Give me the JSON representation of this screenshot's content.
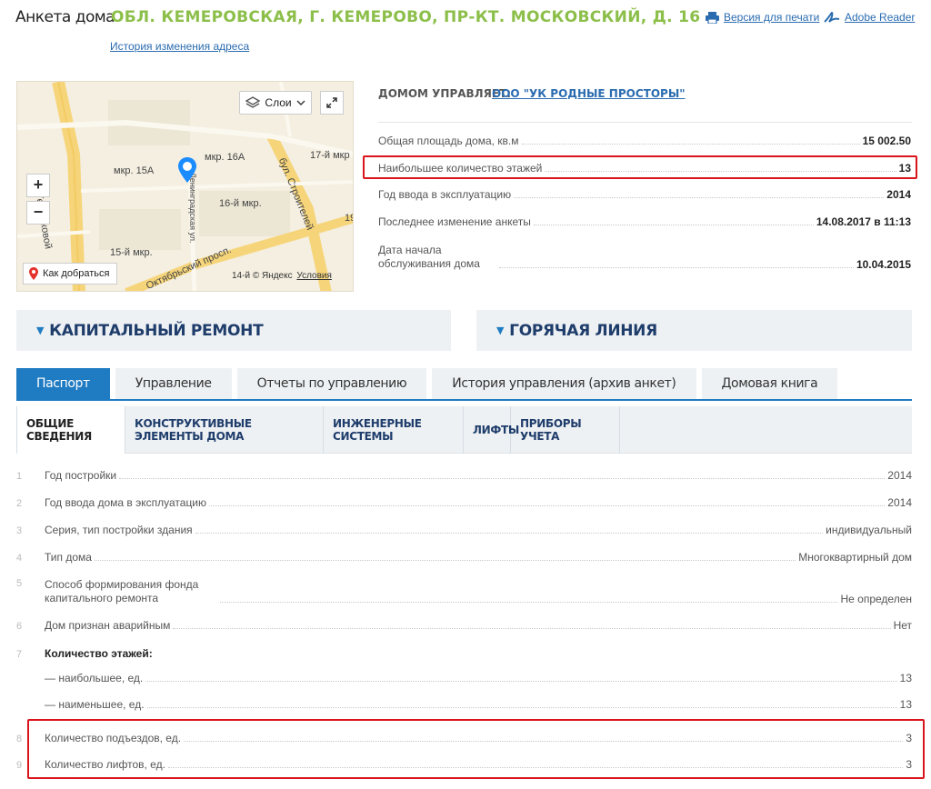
{
  "header": {
    "title": "Анкета дома",
    "address": "ОБЛ. КЕМЕРОВСКАЯ, Г. КЕМЕРОВО, ПР-КТ. МОСКОВСКИЙ, Д. 16",
    "history_link": "История изменения адреса",
    "print_link": "Версия для печати",
    "reader_link": "Adobe Reader"
  },
  "map": {
    "layers_label": "Слои",
    "zoom_in": "+",
    "zoom_out": "−",
    "route_label": "Как добраться",
    "copyright": "© Яндекс",
    "terms": "Условия",
    "labels": {
      "tereshkovoy": "ул. Терешковой",
      "mkr15a": "мкр. 15А",
      "mkr16a": "мкр. 16А",
      "mkr17": "17-й мкр",
      "mkr16": "16-й мкр.",
      "mkr15": "15-й мкр.",
      "mkr14": "14-й",
      "stroiteley": "бул. Строителей",
      "leningradskaya": "Ленинградская ул.",
      "oktyabrsky": "Октябрьский просп.",
      "num19": "19"
    }
  },
  "info": {
    "managed_label": "ДОМОМ УПРАВЛЯЕТ:",
    "managed_company": "ООО \"УК РОДНЫЕ ПРОСТОРЫ\"",
    "rows": [
      {
        "label": "Общая площадь дома, кв.м",
        "value": "15 002.50"
      },
      {
        "label": "Наибольшее количество этажей",
        "value": "13"
      },
      {
        "label": "Год ввода в эксплуатацию",
        "value": "2014"
      },
      {
        "label": "Последнее изменение анкеты",
        "value": "14.08.2017 в 11:13"
      },
      {
        "label": "Дата начала обслуживания дома",
        "value": "10.04.2015"
      }
    ]
  },
  "panels": {
    "capital_repair": "КАПИТАЛЬНЫЙ РЕМОНТ",
    "hotline": "ГОРЯЧАЯ ЛИНИЯ"
  },
  "tabs": [
    "Паспорт",
    "Управление",
    "Отчеты по управлению",
    "История управления (архив анкет)",
    "Домовая книга"
  ],
  "subtabs": [
    "ОБЩИЕ СВЕДЕНИЯ",
    "КОНСТРУКТИВНЫЕ ЭЛЕМЕНТЫ ДОМА",
    "ИНЖЕНЕРНЫЕ СИСТЕМЫ",
    "ЛИФТЫ",
    "ПРИБОРЫ УЧЕТА"
  ],
  "passport": [
    {
      "num": "1",
      "label": "Год постройки",
      "value": "2014"
    },
    {
      "num": "2",
      "label": "Год ввода дома в эксплуатацию",
      "value": "2014"
    },
    {
      "num": "3",
      "label": "Серия, тип постройки здания",
      "value": "индивидуальный"
    },
    {
      "num": "4",
      "label": "Тип дома",
      "value": "Многоквартирный дом"
    },
    {
      "num": "5",
      "label": "Способ формирования фонда капитального ремонта",
      "value": "Не определен"
    },
    {
      "num": "6",
      "label": "Дом признан аварийным",
      "value": "Нет"
    },
    {
      "num": "7",
      "label": "Количество этажей:",
      "value": ""
    },
    {
      "num": "",
      "label": "— наибольшее, ед.",
      "value": "13"
    },
    {
      "num": "",
      "label": "— наименьшее, ед.",
      "value": "13"
    },
    {
      "num": "8",
      "label": "Количество подъездов, ед.",
      "value": "3"
    },
    {
      "num": "9",
      "label": "Количество лифтов, ед.",
      "value": "3"
    }
  ],
  "colors": {
    "accent": "#1f7bc2",
    "address": "#8cbf4a",
    "highlight": "#d9141c",
    "link": "#2b6cb0"
  }
}
